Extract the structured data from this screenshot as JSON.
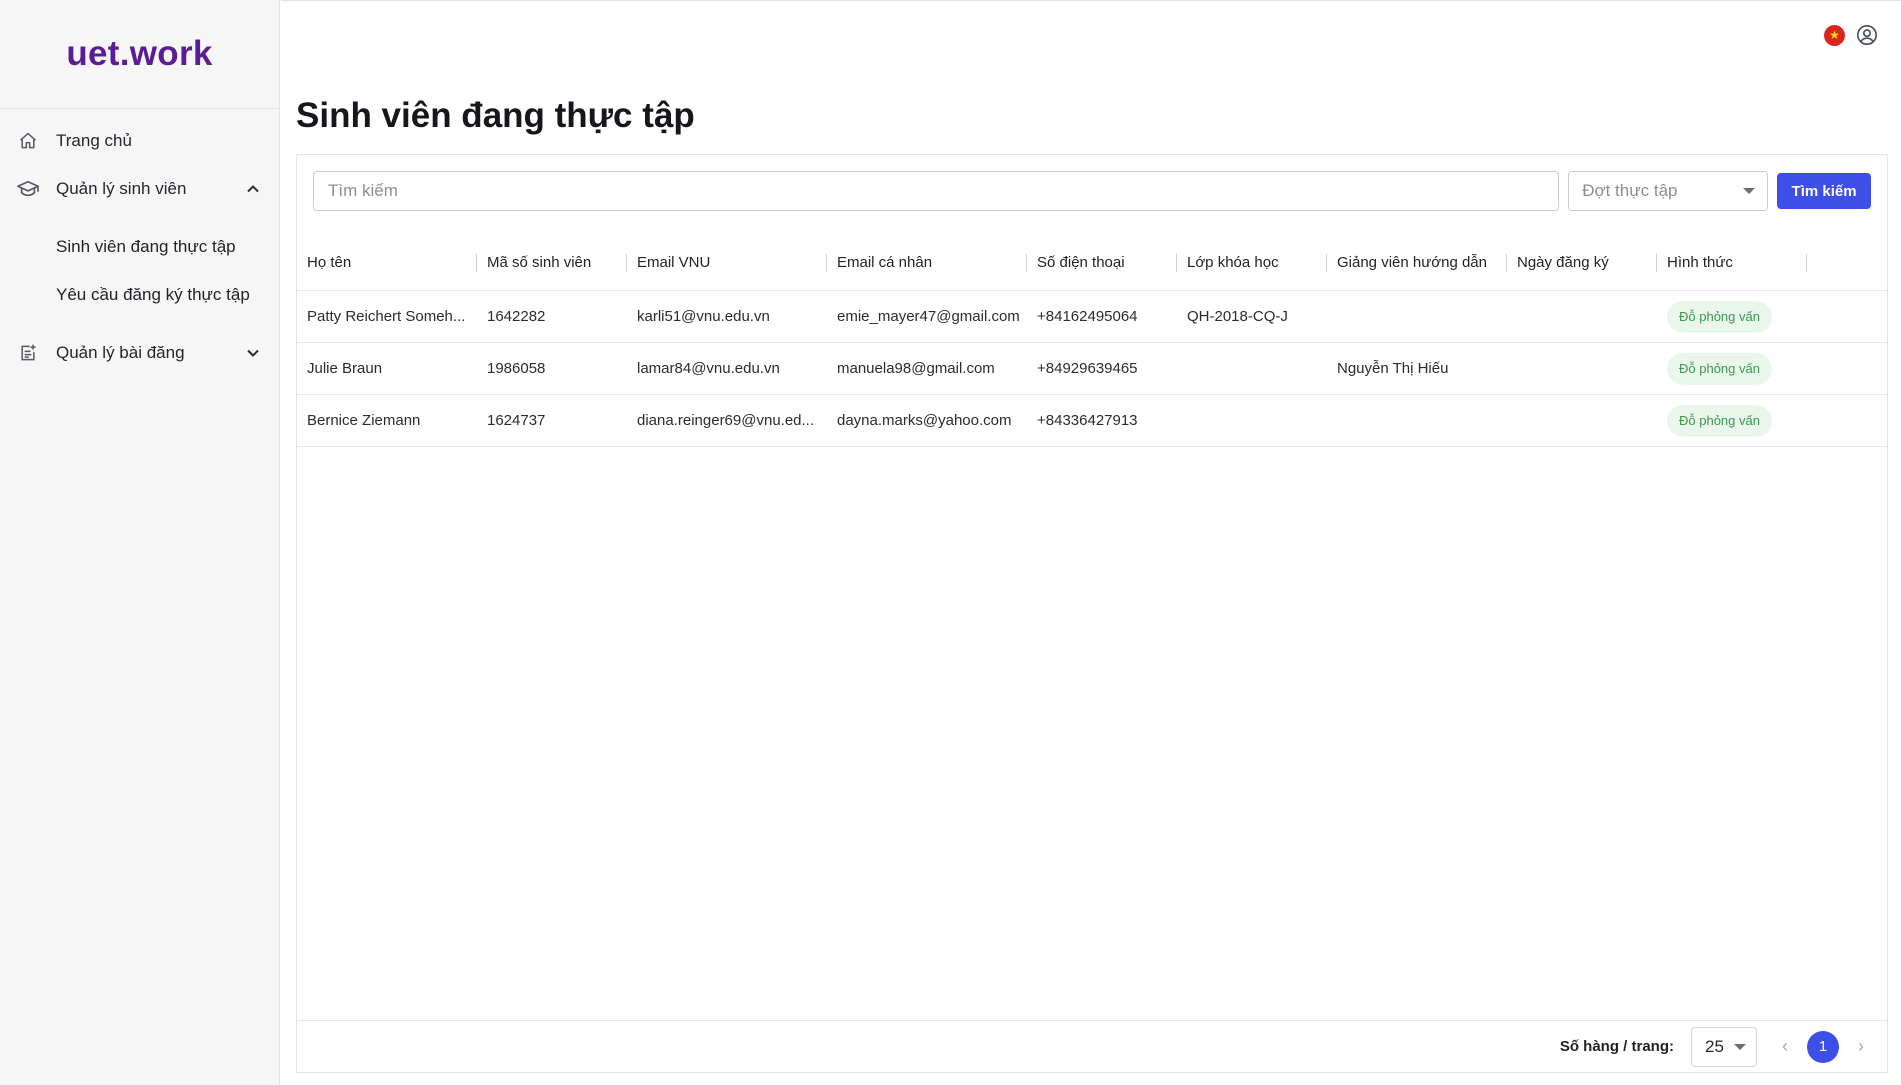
{
  "sidebar": {
    "logo": "uet.work",
    "items": [
      {
        "label": "Trang chủ"
      },
      {
        "label": "Quản lý sinh viên"
      },
      {
        "label": "Quản lý bài đăng"
      }
    ],
    "subitems": [
      {
        "label": "Sinh viên đang thực tập"
      },
      {
        "label": "Yêu cầu đăng ký thực tập"
      }
    ]
  },
  "page": {
    "title": "Sinh viên đang thực tập"
  },
  "toolbar": {
    "search_placeholder": "Tìm kiếm",
    "period_placeholder": "Đợt thực tập",
    "search_button": "Tìm kiếm"
  },
  "table": {
    "columns": [
      "Họ tên",
      "Mã số sinh viên",
      "Email VNU",
      "Email cá nhân",
      "Số điện thoại",
      "Lớp khóa học",
      "Giảng viên hướng dẫn",
      "Ngày đăng ký",
      "Hình thức"
    ],
    "rows": [
      {
        "name": "Patty Reichert Someh...",
        "student_id": "1642282",
        "email_vnu": "karli51@vnu.edu.vn",
        "email_personal": "emie_mayer47@gmail.com",
        "phone": "+84162495064",
        "class": "QH-2018-CQ-J",
        "advisor": "",
        "registered": "",
        "type": "Đỗ phỏng vấn"
      },
      {
        "name": "Julie Braun",
        "student_id": "1986058",
        "email_vnu": "lamar84@vnu.edu.vn",
        "email_personal": "manuela98@gmail.com",
        "phone": "+84929639465",
        "class": "",
        "advisor": "Nguyễn Thị Hiếu",
        "registered": "",
        "type": "Đỗ phỏng vấn"
      },
      {
        "name": "Bernice Ziemann",
        "student_id": "1624737",
        "email_vnu": "diana.reinger69@vnu.ed...",
        "email_personal": "dayna.marks@yahoo.com",
        "phone": "+84336427913",
        "class": "",
        "advisor": "",
        "registered": "",
        "type": "Đỗ phỏng vấn"
      }
    ]
  },
  "pagination": {
    "rows_label": "Số hàng / trang:",
    "rows_per_page": "25",
    "current_page": "1"
  },
  "colors": {
    "accent": "#3d4fe6",
    "logo": "#5b1d94",
    "badge_bg": "#eaf5ec",
    "badge_text": "#3b9a4d"
  }
}
